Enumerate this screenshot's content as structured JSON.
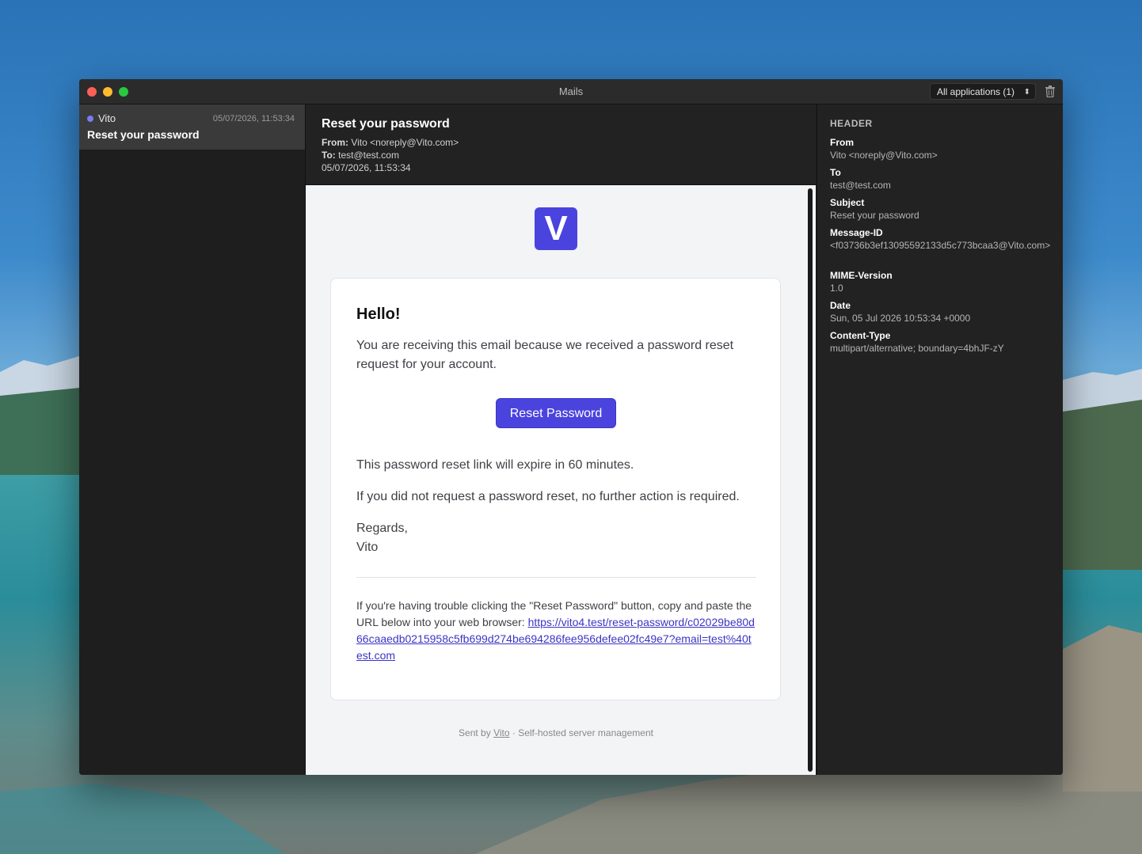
{
  "window": {
    "title": "Mails",
    "app_filter": "All applications (1)"
  },
  "mail_list": [
    {
      "sender": "Vito",
      "date": "05/07/2026, 11:53:34",
      "subject": "Reset your password"
    }
  ],
  "message": {
    "subject": "Reset your password",
    "from_label": "From:",
    "from": "Vito <noreply@Vito.com>",
    "to_label": "To:",
    "to": "test@test.com",
    "date": "05/07/2026, 11:53:34"
  },
  "email_body": {
    "logo_letter": "V",
    "greeting": "Hello!",
    "intro": "You are receiving this email because we received a password reset request for your account.",
    "button_label": "Reset Password",
    "expire_note": "This password reset link will expire in 60 minutes.",
    "no_action": "If you did not request a password reset, no further action is required.",
    "regards": "Regards,",
    "signature": "Vito",
    "trouble_text": "If you're having trouble clicking the \"Reset Password\" button, copy and paste the URL below into your web browser: ",
    "reset_url": "https://vito4.test/reset-password/c02029be80d66caaedb0215958c5fb699d274be694286fee956defee02fc49e7?email=test%40test.com",
    "footer_prefix": "Sent by ",
    "footer_link": "Vito",
    "footer_suffix": " · Self-hosted server management"
  },
  "header_panel": {
    "title": "HEADER",
    "fields": [
      {
        "key": "From",
        "value": "Vito <noreply@Vito.com>"
      },
      {
        "key": "To",
        "value": "test@test.com"
      },
      {
        "key": "Subject",
        "value": "Reset your password"
      },
      {
        "key": "Message-ID",
        "value": "<f03736b3ef13095592133d5c773bcaa3@Vito.com>"
      },
      {
        "key": "MIME-Version",
        "value": "1.0"
      },
      {
        "key": "Date",
        "value": "Sun, 05 Jul 2026 10:53:34 +0000"
      },
      {
        "key": "Content-Type",
        "value": "multipart/alternative; boundary=4bhJF-zY"
      }
    ]
  },
  "colors": {
    "accent": "#4a43dd",
    "unread_dot": "#7b7bf0"
  }
}
